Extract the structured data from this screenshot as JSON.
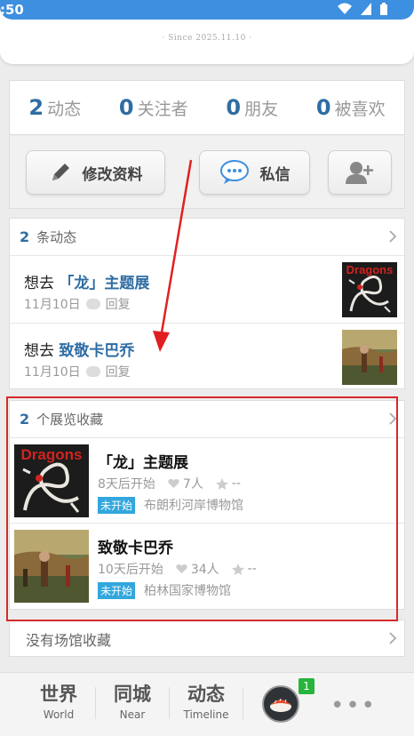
{
  "status": {
    "time": ":50"
  },
  "profile": {
    "since": "· Since 2025.11.10 ·"
  },
  "stats": [
    {
      "num": "2",
      "label": "动态"
    },
    {
      "num": "0",
      "label": "关注者"
    },
    {
      "num": "0",
      "label": "朋友"
    },
    {
      "num": "0",
      "label": "被喜欢"
    }
  ],
  "actions": {
    "edit_label": "修改资料",
    "message_label": "私信"
  },
  "feed": {
    "count": "2",
    "label": "条动态",
    "items": [
      {
        "prefix": "想去 ",
        "title": "「龙」主题展",
        "date": "11月10日",
        "reply": "回复"
      },
      {
        "prefix": "想去 ",
        "title": "致敬卡巴乔",
        "date": "11月10日",
        "reply": "回复"
      }
    ]
  },
  "exhibitions": {
    "count": "2",
    "label": "个展览收藏",
    "items": [
      {
        "title": "「龙」主题展",
        "starts": "8天后开始",
        "likes": "7人",
        "rating": "--",
        "status": "未开始",
        "venue": "布朗利河岸博物馆",
        "thumb_text": "Dragons"
      },
      {
        "title": "致敬卡巴乔",
        "starts": "10天后开始",
        "likes": "34人",
        "rating": "--",
        "status": "未开始",
        "venue": "柏林国家博物馆"
      }
    ]
  },
  "venues": {
    "label": "没有场馆收藏"
  },
  "tabs": [
    {
      "main": "世界",
      "sub": "World"
    },
    {
      "main": "同城",
      "sub": "Near"
    },
    {
      "main": "动态",
      "sub": "Timeline"
    }
  ],
  "notification_badge": "1",
  "more_label": "•••",
  "colors": {
    "accent": "#2f6da3",
    "tag": "#32a7dd",
    "highlight": "#d72a2a",
    "badge": "#27b43c"
  }
}
